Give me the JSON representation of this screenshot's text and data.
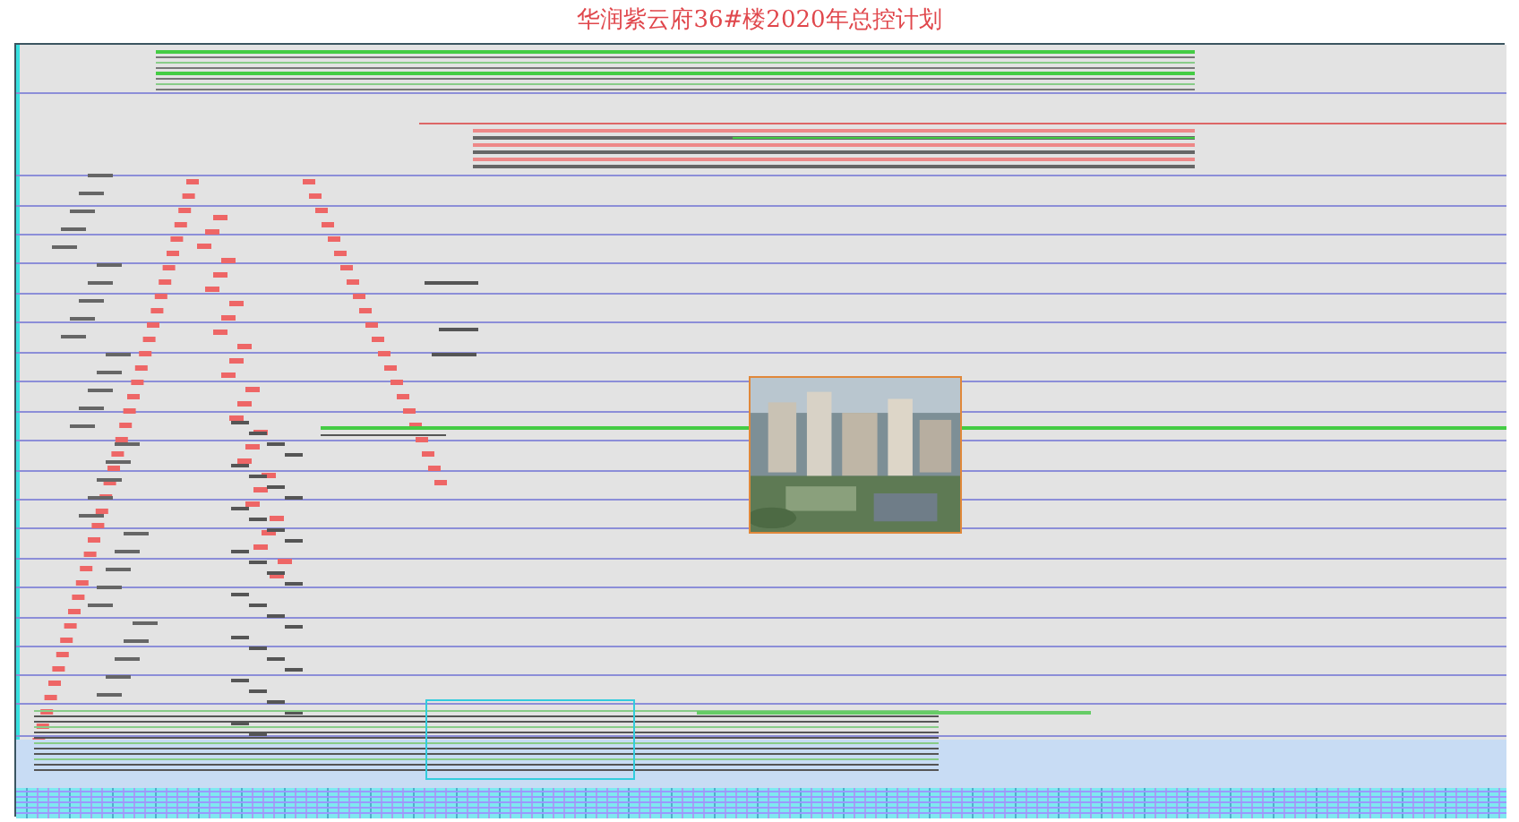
{
  "title": "华润紫云府36#楼2020年总控计划"
}
